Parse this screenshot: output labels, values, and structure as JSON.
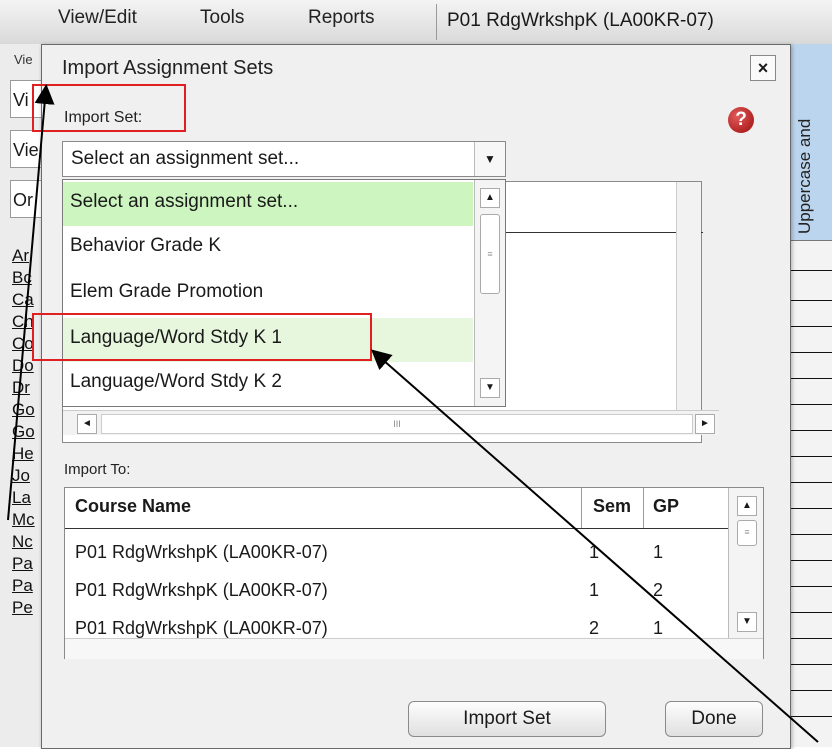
{
  "menubar": {
    "items": [
      "View/Edit",
      "Tools",
      "Reports"
    ],
    "course_tab": "P01  RdgWrkshpK (LA00KR-07)"
  },
  "left_fragments": {
    "small": "Vie",
    "boxes": [
      "Vi",
      "Vie",
      "Or"
    ],
    "links": [
      "Ar",
      "Bc",
      "Ca",
      "Ch",
      "Co",
      "Do",
      "Dr",
      "Go",
      "Go",
      "He",
      "Jo",
      "La",
      "Mc",
      "Nc",
      "Pa",
      "Pa",
      "Pe"
    ]
  },
  "right_header": {
    "text": "Uppercase and"
  },
  "dialog": {
    "title": "Import Assignment Sets",
    "close_label": "×",
    "import_set_label": "Import Set:",
    "help_icon_label": "?",
    "select_value": "Select an assignment set...",
    "options": [
      "Select an assignment set...",
      "Behavior Grade K",
      "Elem Grade Promotion",
      "Language/Word Stdy K 1",
      "Language/Word Stdy K 2"
    ],
    "selected_option": "Select an assignment set...",
    "highlighted_option": "Language/Word Stdy K 1",
    "import_to_label": "Import To:",
    "table": {
      "columns": [
        "Course Name",
        "Sem",
        "GP"
      ],
      "rows": [
        [
          "P01  RdgWrkshpK (LA00KR-07)",
          "1",
          "1"
        ],
        [
          "P01  RdgWrkshpK (LA00KR-07)",
          "1",
          "2"
        ],
        [
          "P01  RdgWrkshpK (LA00KR-07)",
          "2",
          "1"
        ]
      ]
    },
    "import_button": "Import Set",
    "done_button": "Done"
  },
  "scroll_glyphs": {
    "up": "▲",
    "down": "▼",
    "left": "◄",
    "right": "►",
    "grip": "≡",
    "grip_h": "III",
    "select_arrow": "▼"
  },
  "colors": {
    "selected_option": "#ccf5bf",
    "highlight_option": "#e7f7dd",
    "annotation": "#e02020",
    "help_icon": "#b01515",
    "right_header": "#bcd5ee"
  }
}
